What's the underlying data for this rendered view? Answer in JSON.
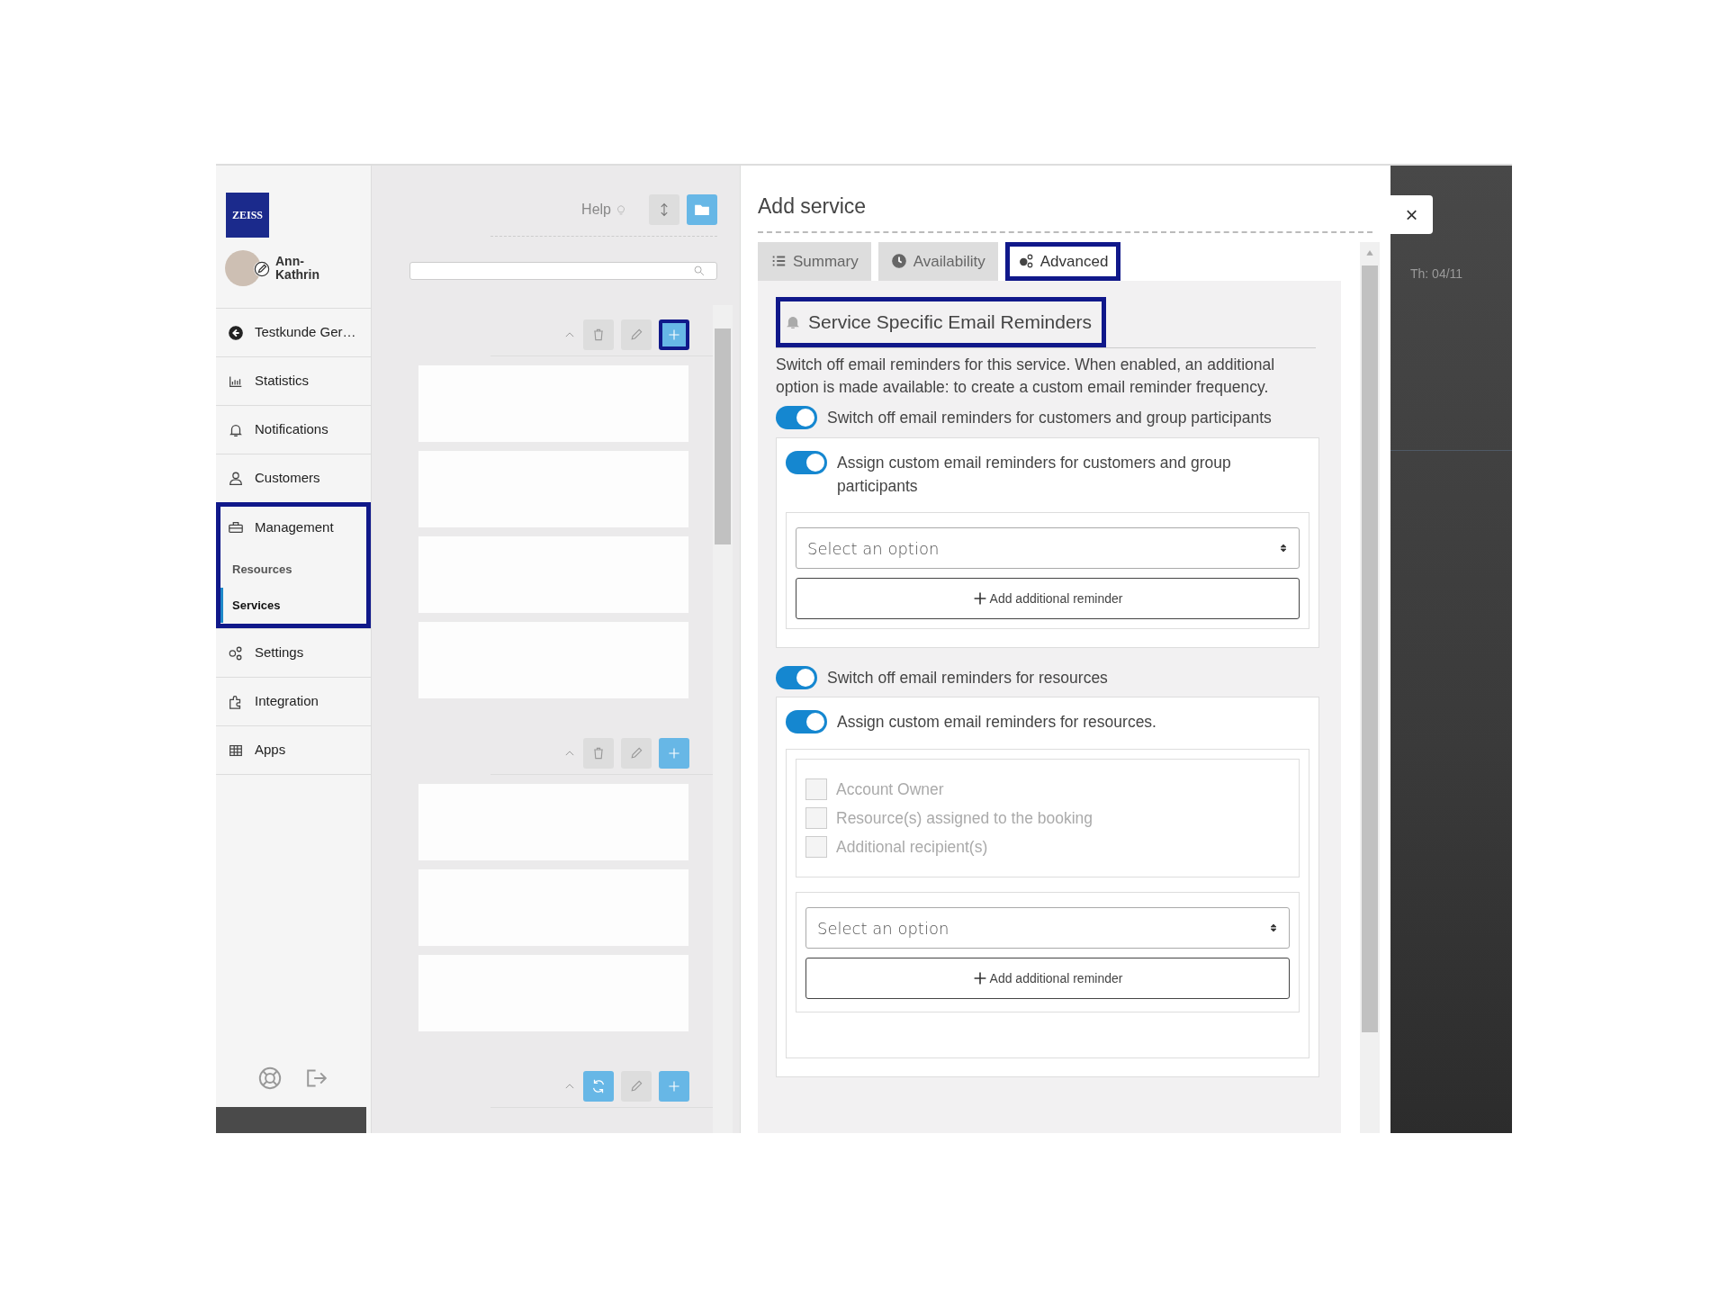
{
  "sidebar": {
    "logo": "ZEISS",
    "user": "Ann-Kathrin",
    "items": [
      {
        "kind": "back",
        "label": "Testkunde Ger…"
      },
      {
        "kind": "statistics",
        "label": "Statistics"
      },
      {
        "kind": "notifications",
        "label": "Notifications"
      },
      {
        "kind": "customers",
        "label": "Customers"
      },
      {
        "kind": "management",
        "label": "Management",
        "highlighted": true,
        "children": [
          {
            "label": "Resources",
            "selected": false
          },
          {
            "label": "Services",
            "selected": true
          }
        ]
      },
      {
        "kind": "settings",
        "label": "Settings"
      },
      {
        "kind": "integration",
        "label": "Integration"
      },
      {
        "kind": "apps",
        "label": "Apps"
      }
    ]
  },
  "list_panel": {
    "help": "Help",
    "groups": [
      {
        "kind": "delete",
        "add_highlighted": true
      },
      {
        "kind": "delete",
        "add_highlighted": false
      },
      {
        "kind": "refresh",
        "add_highlighted": false
      }
    ]
  },
  "modal": {
    "title": "Add service",
    "tabs": [
      {
        "kind": "summary",
        "label": "Summary",
        "selected": false,
        "highlighted": false
      },
      {
        "kind": "availability",
        "label": "Availability",
        "selected": false,
        "highlighted": false
      },
      {
        "kind": "advanced",
        "label": "Advanced",
        "selected": true,
        "highlighted": true
      }
    ],
    "section": {
      "title": "Service Specific Email Reminders",
      "highlighted": true,
      "description": "Switch off email reminders for this service. When enabled, an additional option is made available: to create a custom email reminder frequency."
    },
    "customers": {
      "switch": {
        "label": "Switch off email reminders for customers and group participants",
        "on": true
      },
      "custom": {
        "label": "Assign custom email reminders for customers and group participants",
        "on": true
      },
      "select": {
        "placeholder": "Select an option"
      },
      "add_button": "Add additional reminder"
    },
    "resources": {
      "switch": {
        "label": "Switch off email reminders for resources",
        "on": true
      },
      "custom": {
        "label": "Assign custom email reminders for resources.",
        "on": true
      },
      "recipients": [
        {
          "label": "Account Owner",
          "checked": false,
          "disabled": true
        },
        {
          "label": "Resource(s) assigned to the booking",
          "checked": false,
          "disabled": true
        },
        {
          "label": "Additional recipient(s)",
          "checked": false,
          "disabled": true
        }
      ],
      "select": {
        "placeholder": "Select an option"
      },
      "add_button": "Add additional reminder"
    }
  },
  "close": "×",
  "background": {
    "date": "Th: 04/11"
  }
}
